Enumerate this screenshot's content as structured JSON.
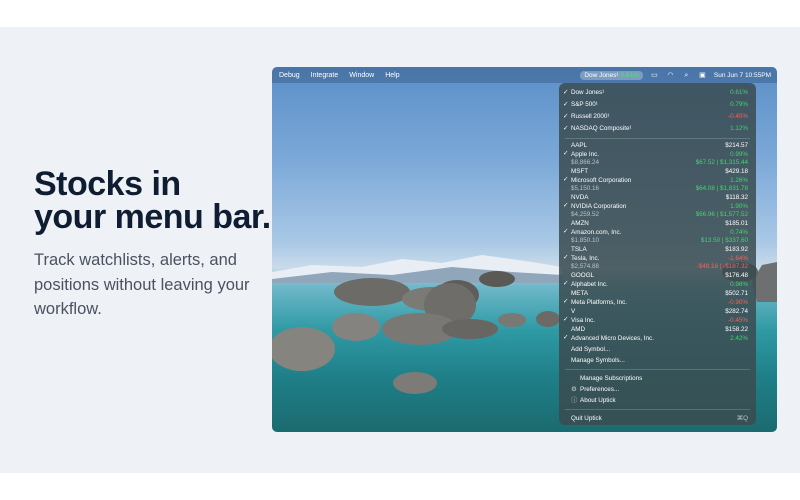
{
  "headline": {
    "line1": "Stocks in",
    "line2": "your menu bar."
  },
  "subtext": "Track watchlists, alerts, and positions without leaving your workflow.",
  "menubar": {
    "items": [
      "Debug",
      "Integrate",
      "Window",
      "Help"
    ],
    "ticker_label": "Dow Jones¹",
    "ticker_change": "0.61%",
    "date_time": "Sun Jun 7  10:55PM"
  },
  "menu": {
    "indices": [
      {
        "name": "Dow Jones¹",
        "change": "0.61%",
        "dir": "up"
      },
      {
        "name": "S&P 500¹",
        "change": "0.79%",
        "dir": "up"
      },
      {
        "name": "Russell 2000¹",
        "change": "-0.40%",
        "dir": "down"
      },
      {
        "name": "NASDAQ Composite¹",
        "change": "1.12%",
        "dir": "up"
      }
    ],
    "stocks": [
      {
        "symbol": "AAPL",
        "name": "Apple Inc.",
        "price": "$214.57",
        "change": "0.99%",
        "position": "$8,866.24",
        "gain": "$67.52 | $1,315.44",
        "dir": "up"
      },
      {
        "symbol": "MSFT",
        "name": "Microsoft Corporation",
        "price": "$429.18",
        "change": "1.26%",
        "position": "$5,150.16",
        "gain": "$64.08 | $1,831.78",
        "dir": "up"
      },
      {
        "symbol": "NVDA",
        "name": "NVIDIA Corporation",
        "price": "$118.32",
        "change": "1.90%",
        "position": "$4,259.52",
        "gain": "$66.96 | $1,577.52",
        "dir": "up"
      },
      {
        "symbol": "AMZN",
        "name": "Amazon.com, Inc.",
        "price": "$185.01",
        "change": "0.74%",
        "position": "$1,850.10",
        "gain": "$13.50 | $337.60",
        "dir": "up"
      },
      {
        "symbol": "TSLA",
        "name": "Tesla, Inc.",
        "price": "$183.92",
        "change": "-1.64%",
        "position": "$2,574.88",
        "gain": "-$48.16 | -$187.32",
        "dir": "down"
      },
      {
        "symbol": "GOOGL",
        "name": "Alphabet Inc.",
        "price": "$176.48",
        "change": "0.98%",
        "position": "",
        "gain": "",
        "dir": "up"
      },
      {
        "symbol": "META",
        "name": "Meta Platforms, Inc.",
        "price": "$502.71",
        "change": "-0.90%",
        "position": "",
        "gain": "",
        "dir": "down"
      },
      {
        "symbol": "V",
        "name": "Visa Inc.",
        "price": "$282.74",
        "change": "-0.45%",
        "position": "",
        "gain": "",
        "dir": "down"
      },
      {
        "symbol": "AMD",
        "name": "Advanced Micro Devices, Inc.",
        "price": "$158.22",
        "change": "2.42%",
        "position": "",
        "gain": "",
        "dir": "up"
      }
    ],
    "add_symbol": "Add Symbol...",
    "manage_symbols": "Manage Symbols...",
    "manage_subscriptions": "Manage Subscriptions",
    "preferences": "Preferences...",
    "about": "About Uptick",
    "quit": "Quit Uptick",
    "quit_shortcut": "⌘Q"
  },
  "colors": {
    "up": "#3ed86a",
    "down": "#ff5e55"
  }
}
